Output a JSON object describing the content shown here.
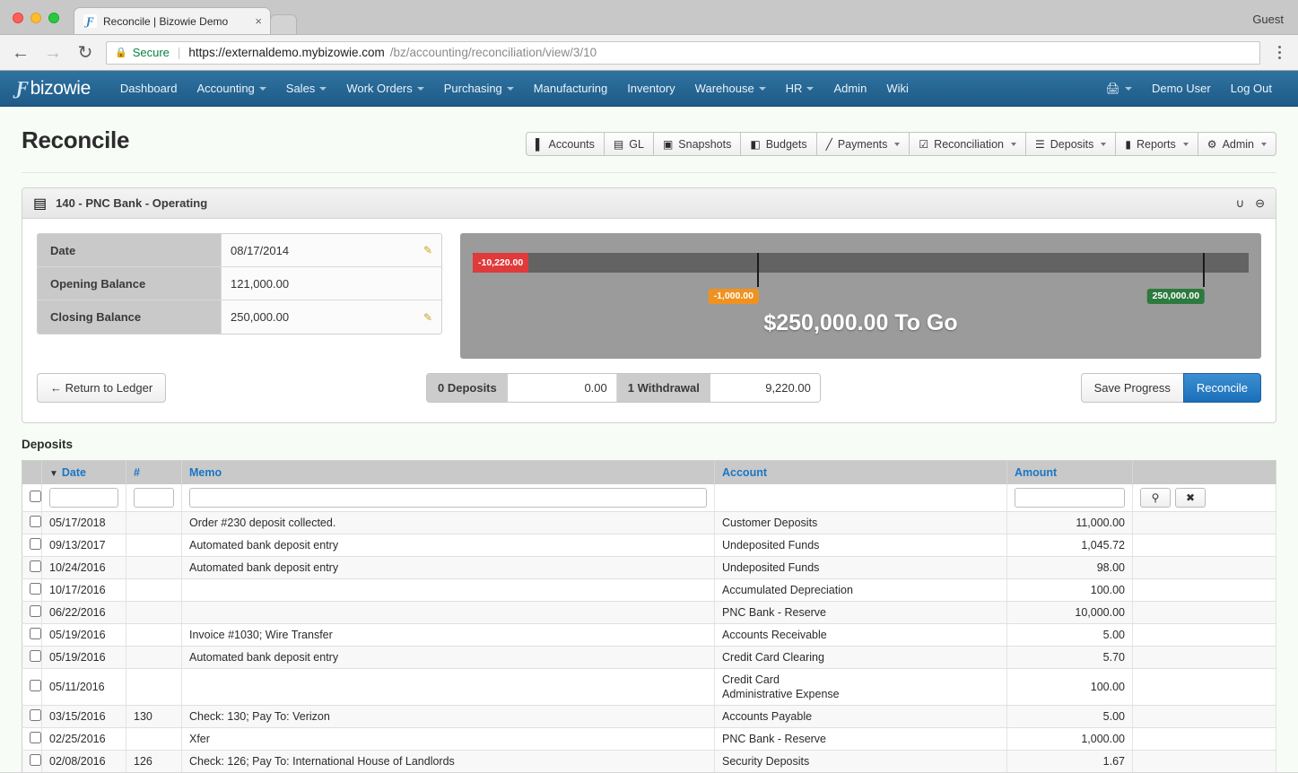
{
  "browser": {
    "tab_title": "Reconcile | Bizowie Demo",
    "tab_close": "×",
    "favicon_glyph": "Ƒ",
    "guest_label": "Guest",
    "back_glyph": "←",
    "forward_glyph": "→",
    "reload_glyph": "↻",
    "lock_glyph": "🔒",
    "secure_label": "Secure",
    "url_sep": "|",
    "url_main": "https://externaldemo.mybizowie.com",
    "url_path": "/bz/accounting/reconciliation/view/3/10"
  },
  "appnav": {
    "brand_mark": "Ƒ",
    "brand_text": "bizowie",
    "items": [
      {
        "label": "Dashboard",
        "caret": false
      },
      {
        "label": "Accounting",
        "caret": true
      },
      {
        "label": "Sales",
        "caret": true
      },
      {
        "label": "Work Orders",
        "caret": true
      },
      {
        "label": "Purchasing",
        "caret": true
      },
      {
        "label": "Manufacturing",
        "caret": false
      },
      {
        "label": "Inventory",
        "caret": false
      },
      {
        "label": "Warehouse",
        "caret": true
      },
      {
        "label": "HR",
        "caret": true
      },
      {
        "label": "Admin",
        "caret": false
      },
      {
        "label": "Wiki",
        "caret": false
      }
    ],
    "right": {
      "print_icon": "🖨",
      "user": "Demo User",
      "logout": "Log Out"
    }
  },
  "page": {
    "title": "Reconcile"
  },
  "toolbar": [
    {
      "label": "Accounts",
      "icon": "▌",
      "icon_name": "book-icon",
      "caret": false
    },
    {
      "label": "GL",
      "icon": "▤",
      "icon_name": "ledger-icon",
      "caret": false
    },
    {
      "label": "Snapshots",
      "icon": "▣",
      "icon_name": "camera-icon",
      "caret": false
    },
    {
      "label": "Budgets",
      "icon": "◧",
      "icon_name": "file-icon",
      "caret": false
    },
    {
      "label": "Payments",
      "icon": "╱",
      "icon_name": "pencil-icon",
      "caret": true
    },
    {
      "label": "Reconciliation",
      "icon": "☑",
      "icon_name": "check-square-icon",
      "caret": true
    },
    {
      "label": "Deposits",
      "icon": "☰",
      "icon_name": "list-icon",
      "caret": true
    },
    {
      "label": "Reports",
      "icon": "▮",
      "icon_name": "trash-icon",
      "caret": true
    },
    {
      "label": "Admin",
      "icon": "⚙",
      "icon_name": "gear-icon",
      "caret": true
    }
  ],
  "panel": {
    "icon": "▤",
    "title": "140 - PNC Bank - Operating",
    "magnet_icon": "∪",
    "collapse_icon": "⊖",
    "rows": [
      {
        "label": "Date",
        "value": "08/17/2014",
        "editable": true
      },
      {
        "label": "Opening Balance",
        "value": "121,000.00",
        "editable": false
      },
      {
        "label": "Closing Balance",
        "value": "250,000.00",
        "editable": true
      }
    ]
  },
  "gauge": {
    "start_badge": "-10,220.00",
    "mid_badge": "-1,000.00",
    "end_badge": "250,000.00",
    "message": "$250,000.00 To Go",
    "mid_pos_pct": 33.5,
    "end_pos_pct": 90.5,
    "colors": {
      "start": "#e03a3a",
      "mid": "#f0921f",
      "end": "#2d7a3e",
      "track": "#636363",
      "bg": "#9b9b9b"
    }
  },
  "actions": {
    "return_label": "← Return to Ledger",
    "deposits_label": "0 Deposits",
    "deposits_value": "0.00",
    "withdrawal_label": "1 Withdrawal",
    "withdrawal_value": "9,220.00",
    "save_label": "Save Progress",
    "reconcile_label": "Reconcile"
  },
  "deposits": {
    "section_title": "Deposits",
    "columns": [
      {
        "key": "chk",
        "label": ""
      },
      {
        "key": "date",
        "label": "Date",
        "sorted": true,
        "sort_glyph": "▼"
      },
      {
        "key": "num",
        "label": "#"
      },
      {
        "key": "memo",
        "label": "Memo"
      },
      {
        "key": "account",
        "label": "Account"
      },
      {
        "key": "amount",
        "label": "Amount"
      },
      {
        "key": "actions",
        "label": ""
      }
    ],
    "filter_row": {
      "date": "",
      "num": "",
      "memo": "",
      "account": "",
      "amount": "",
      "search_icon": "⚲",
      "clear_icon": "✖"
    },
    "rows": [
      {
        "date": "05/17/2018",
        "num": "",
        "memo": "Order #230 deposit collected.",
        "account": "Customer Deposits",
        "amount": "11,000.00"
      },
      {
        "date": "09/13/2017",
        "num": "",
        "memo": "Automated bank deposit entry",
        "account": "Undeposited Funds",
        "amount": "1,045.72"
      },
      {
        "date": "10/24/2016",
        "num": "",
        "memo": "Automated bank deposit entry",
        "account": "Undeposited Funds",
        "amount": "98.00"
      },
      {
        "date": "10/17/2016",
        "num": "",
        "memo": "",
        "account": "Accumulated Depreciation",
        "amount": "100.00"
      },
      {
        "date": "06/22/2016",
        "num": "",
        "memo": "",
        "account": "PNC Bank - Reserve",
        "amount": "10,000.00"
      },
      {
        "date": "05/19/2016",
        "num": "",
        "memo": "Invoice #1030; Wire Transfer",
        "account": "Accounts Receivable",
        "amount": "5.00"
      },
      {
        "date": "05/19/2016",
        "num": "",
        "memo": "Automated bank deposit entry",
        "account": "Credit Card Clearing",
        "amount": "5.70"
      },
      {
        "date": "05/11/2016",
        "num": "",
        "memo": "",
        "account": "Credit Card\nAdministrative Expense",
        "amount": "100.00",
        "tall": true
      },
      {
        "date": "03/15/2016",
        "num": "130",
        "memo": "Check: 130; Pay To: Verizon",
        "account": "Accounts Payable",
        "amount": "5.00"
      },
      {
        "date": "02/25/2016",
        "num": "",
        "memo": "Xfer",
        "account": "PNC Bank - Reserve",
        "amount": "1,000.00"
      },
      {
        "date": "02/08/2016",
        "num": "126",
        "memo": "Check: 126; Pay To: International House of Landlords",
        "account": "Security Deposits",
        "amount": "1.67"
      }
    ]
  }
}
